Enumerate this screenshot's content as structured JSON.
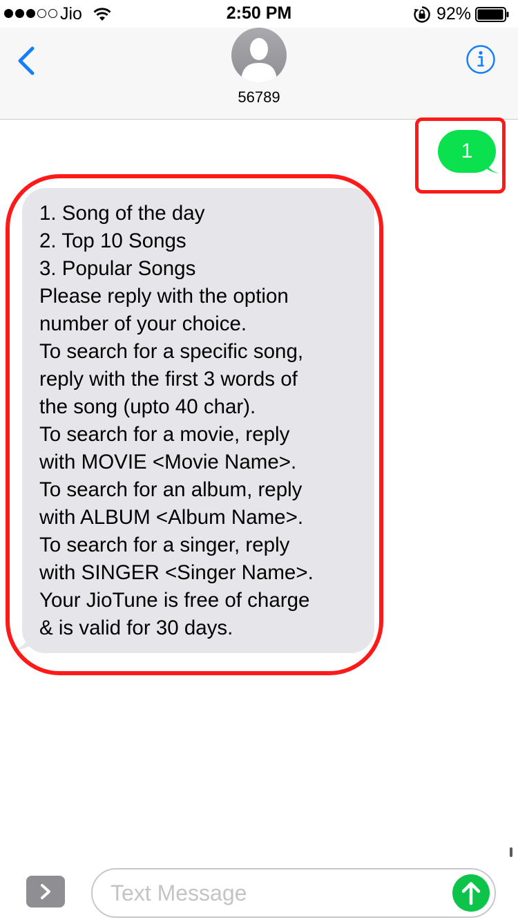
{
  "status_bar": {
    "signal_bars_filled": 3,
    "signal_bars_total": 5,
    "carrier": "Jio",
    "time": "2:50 PM",
    "battery_percent": "92%",
    "battery_level": 0.92,
    "icons": [
      "wifi-icon",
      "rotation-lock-icon",
      "battery-icon"
    ]
  },
  "header": {
    "contact_name": "56789",
    "icons": [
      "back-chevron-icon",
      "contact-avatar",
      "info-icon"
    ]
  },
  "conversation": {
    "sent_message": "1",
    "received_lines": [
      "1. Song of the day",
      "2. Top 10 Songs",
      "3. Popular Songs",
      "Please reply with the option",
      "number of your choice.",
      "To search for a specific song,",
      "reply with the first 3 words of",
      "the song (upto 40 char).",
      "To search for a movie, reply",
      "with MOVIE <Movie Name>.",
      "To search for an album, reply",
      "with ALBUM <Album Name>.",
      "To search for a singer, reply",
      "with SINGER <Singer Name>.",
      "Your JioTune is free of charge",
      "& is valid for 30 days."
    ]
  },
  "compose": {
    "placeholder": "Text Message",
    "value": "",
    "icons": [
      "apps-chevron-icon",
      "send-arrow-icon"
    ]
  },
  "colors": {
    "ios_blue": "#157efb",
    "sent_bubble": "#0be14f",
    "received_bubble": "#e5e5ea",
    "highlight_outline": "#ff1a1a",
    "send_button": "#0ec34a"
  }
}
